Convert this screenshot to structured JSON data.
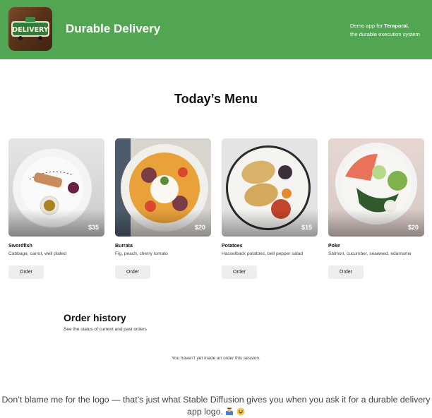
{
  "header": {
    "logo_text": "DELIVERY",
    "title": "Durable Delivery",
    "tagline_prefix": "Demo app for ",
    "tagline_brand": "Temporal",
    "tagline_suffix": ",",
    "tagline_line2": "the durable execution system"
  },
  "menu": {
    "title": "Today’s Menu",
    "items": [
      {
        "name": "Swordfish",
        "description": "Cabbage, carrot, well plated",
        "price": "$35",
        "button": "Order"
      },
      {
        "name": "Burrata",
        "description": "Fig, peach, cherry tomato",
        "price": "$20",
        "button": "Order"
      },
      {
        "name": "Potatoes",
        "description": "Hasselback potatoes, bell pepper salad",
        "price": "$15",
        "button": "Order"
      },
      {
        "name": "Poke",
        "description": "Salmon, cucumber, seaweed, edamame",
        "price": "$20",
        "button": "Order"
      }
    ]
  },
  "history": {
    "title": "Order history",
    "subtitle": "See the status of current and past orders",
    "empty_message": "You haven't yet made an order this session."
  },
  "note": {
    "line1": "Don’t blame me for the logo — that’s just what Stable Diffusion gives you when you ask it for a durable delivery",
    "line2": "app logo."
  },
  "colors": {
    "header_bg": "#52a552",
    "button_bg": "#eeeeef"
  }
}
